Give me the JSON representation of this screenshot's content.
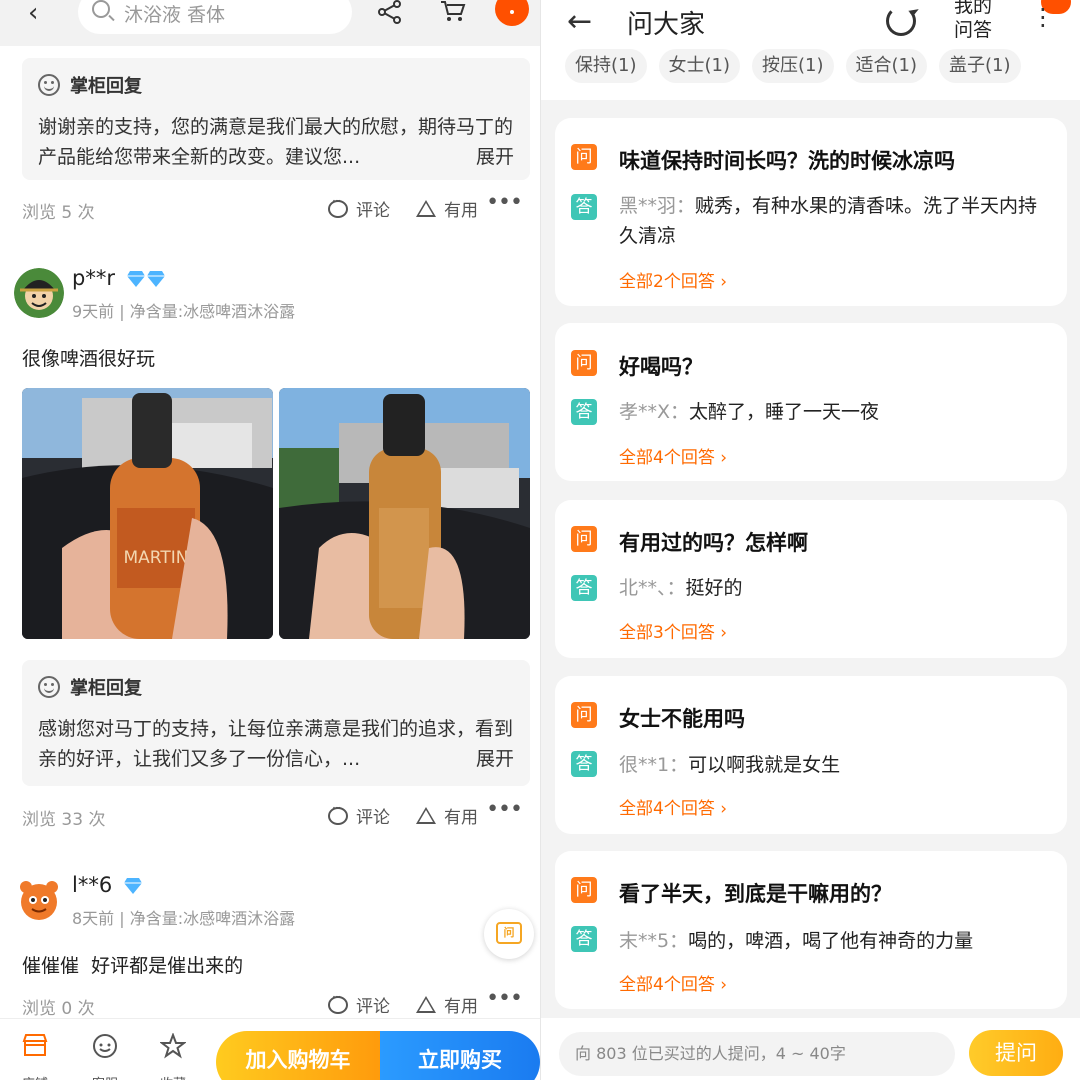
{
  "left": {
    "search_placeholder": "沐浴液 香体",
    "reply1": {
      "title": "掌柜回复",
      "text": "谢谢亲的支持，您的满意是我们最大的欣慰，期待马丁的产品能给您带来全新的改变。建议您...",
      "expand": "展开"
    },
    "stats1": {
      "views": "浏览 5 次",
      "comment": "评论",
      "useful": "有用"
    },
    "review2": {
      "user": "p**r",
      "meta": "9天前 | 净含量:冰感啤酒沐浴露",
      "text": "很像啤酒很好玩",
      "bottle_brand": "MARTIN"
    },
    "reply2": {
      "title": "掌柜回复",
      "text": "感谢您对马丁的支持，让每位亲满意是我们的追求，看到亲的好评，让我们又多了一份信心，...",
      "expand": "展开"
    },
    "stats2": {
      "views": "浏览 33 次",
      "comment": "评论",
      "useful": "有用"
    },
    "review3": {
      "user": "l**6",
      "meta": "8天前 | 净含量:冰感啤酒沐浴露",
      "text": "催催催  好评都是催出来的"
    },
    "stats3": {
      "views": "浏览 0 次",
      "comment": "评论",
      "useful": "有用"
    },
    "float_label": "问",
    "bottom": {
      "shop": "店铺",
      "service": "客服",
      "favorite": "收藏",
      "add_cart": "加入购物车",
      "buy_now": "立即购买"
    }
  },
  "right": {
    "title": "问大家",
    "my_qa": "我的问答",
    "chips": [
      "保持(1)",
      "女士(1)",
      "按压(1)",
      "适合(1)",
      "盖子(1)"
    ],
    "q_tag": "问",
    "a_tag": "答",
    "qa": [
      {
        "question": "味道保持时间长吗？洗的时候冰凉吗",
        "user": "黑**羽：",
        "answer": "贼秀，有种水果的清香味。洗了半天内持久清凉",
        "all": "全部2个回答"
      },
      {
        "question": "好喝吗？",
        "user": "孝**X：",
        "answer": "太醉了，睡了一天一夜",
        "all": "全部4个回答"
      },
      {
        "question": "有用过的吗？怎样啊",
        "user": "北**、：",
        "answer": "挺好的",
        "all": "全部3个回答"
      },
      {
        "question": "女士不能用吗",
        "user": "很**1：",
        "answer": "可以啊我就是女生",
        "all": "全部4个回答"
      },
      {
        "question": "看了半天，到底是干嘛用的？",
        "user": "末**5：",
        "answer": "喝的，啤酒，喝了他有神奇的力量",
        "all": "全部4个回答"
      }
    ],
    "ask_placeholder": "向 803 位已买过的人提问，4 ~ 40字",
    "ask_button": "提问"
  },
  "colors": {
    "accent_orange": "#ff6a00",
    "question_tag": "#ff7a1a",
    "answer_tag": "#3fc6b6",
    "cart_button": "#ffb31a",
    "buy_button": "#1a7bf0"
  }
}
